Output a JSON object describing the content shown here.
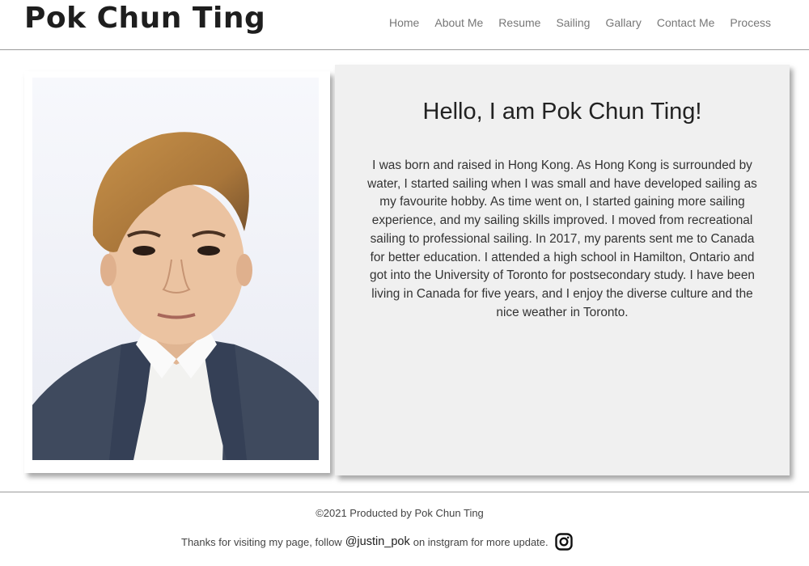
{
  "header": {
    "brand": "Pok Chun Ting",
    "nav": [
      {
        "label": "Home"
      },
      {
        "label": "About Me"
      },
      {
        "label": "Resume"
      },
      {
        "label": "Sailing"
      },
      {
        "label": "Gallary"
      },
      {
        "label": "Contact Me"
      },
      {
        "label": "Process"
      }
    ]
  },
  "main": {
    "title": "Hello, I am Pok Chun Ting!",
    "bio": "I was born and raised in Hong Kong. As Hong Kong is surrounded by water, I started sailing when I was small and have developed sailing as my favourite hobby. As time went on, I started gaining more sailing experience, and my sailing skills improved. I moved from recreational sailing to professional sailing. In 2017, my parents sent me to Canada for better education. I attended a high school in Hamilton, Ontario and got into the University of Toronto for postsecondary study. I have been living in Canada for five years, and I enjoy the diverse culture and the nice weather in Toronto."
  },
  "footer": {
    "copyright": "©2021 Producted by Pok Chun Ting",
    "thanks_before": "Thanks for visiting my page, follow",
    "handle": "@justin_pok",
    "thanks_after": "on instgram for more update.",
    "icon": "instagram-icon"
  },
  "colors": {
    "bio_card_bg": "#f0f0f0",
    "nav_text": "#777777",
    "divider": "#9a9a9a"
  }
}
